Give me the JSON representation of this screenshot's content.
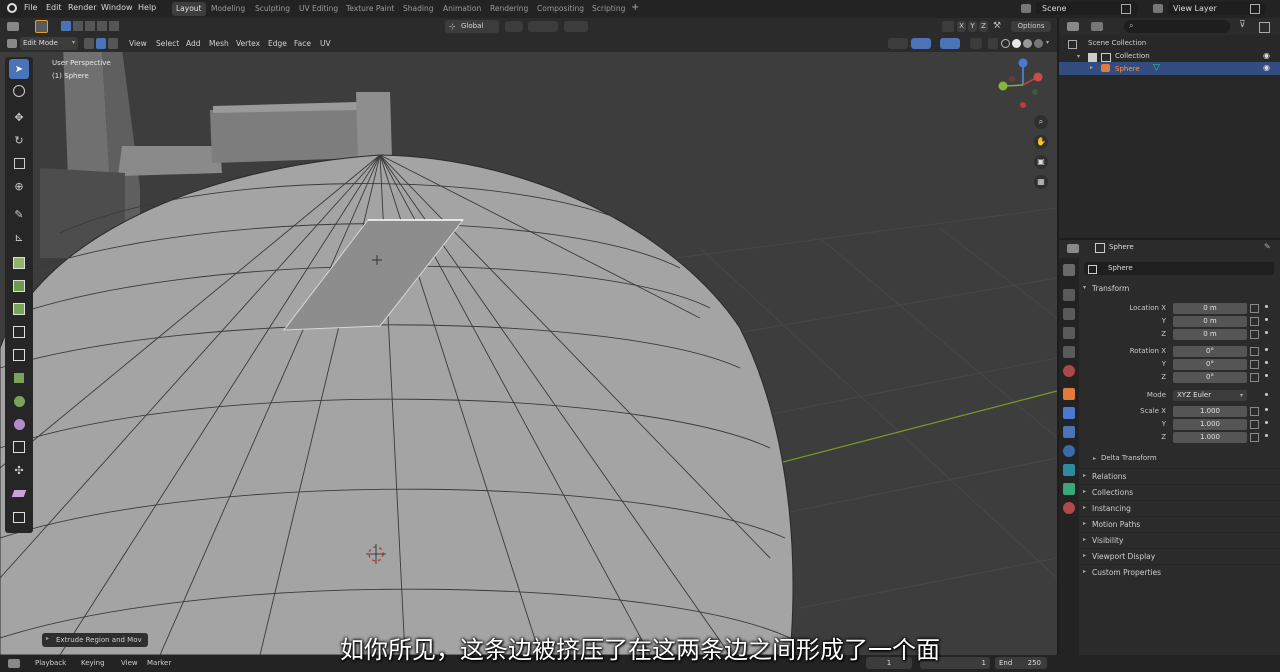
{
  "menubar": {
    "menus": [
      "File",
      "Edit",
      "Render",
      "Window",
      "Help"
    ],
    "workspaces": [
      "Layout",
      "Modeling",
      "Sculpting",
      "UV Editing",
      "Texture Paint",
      "Shading",
      "Animation",
      "Rendering",
      "Compositing",
      "Scripting"
    ],
    "active_workspace": "Layout",
    "scene": "Scene",
    "view_layer": "View Layer"
  },
  "viewport_header": {
    "orientation": "Global",
    "axes": [
      "X",
      "Y",
      "Z"
    ],
    "options": "Options",
    "mode": "Edit Mode",
    "menus": [
      "View",
      "Select",
      "Add",
      "Mesh",
      "Vertex",
      "Edge",
      "Face",
      "UV"
    ]
  },
  "viewport": {
    "view_name": "User Perspective",
    "object_name": "(1) Sphere",
    "operator_panel": "Extrude Region and Mov"
  },
  "outliner": {
    "scene_collection": "Scene Collection",
    "collection": "Collection",
    "object": "Sphere"
  },
  "properties": {
    "object_name_header": "Sphere",
    "object_name_field": "Sphere",
    "transform_title": "Transform",
    "location": {
      "label_x": "Location X",
      "label_y": "Y",
      "label_z": "Z",
      "x": "0 m",
      "y": "0 m",
      "z": "0 m"
    },
    "rotation": {
      "label_x": "Rotation X",
      "label_y": "Y",
      "label_z": "Z",
      "x": "0°",
      "y": "0°",
      "z": "0°"
    },
    "mode_label": "Mode",
    "mode_value": "XYZ Euler",
    "scale": {
      "label_x": "Scale X",
      "label_y": "Y",
      "label_z": "Z",
      "x": "1.000",
      "y": "1.000",
      "z": "1.000"
    },
    "delta_transform": "Delta Transform",
    "panels": [
      "Relations",
      "Collections",
      "Instancing",
      "Motion Paths",
      "Visibility",
      "Viewport Display",
      "Custom Properties"
    ]
  },
  "timeline": {
    "menus": [
      "Playback",
      "Keying",
      "View",
      "Marker"
    ],
    "current_frame": "1",
    "start": "1",
    "end_label": "End",
    "end": "250"
  },
  "subtitle": "如你所见，这条边被挤压了在这两条边之间形成了一个面",
  "colors": {
    "accent": "#4a73b8",
    "selection": "#ff8c2a",
    "viewport_bg": "#3d3d3d",
    "mesh": "#9a9a9a"
  }
}
